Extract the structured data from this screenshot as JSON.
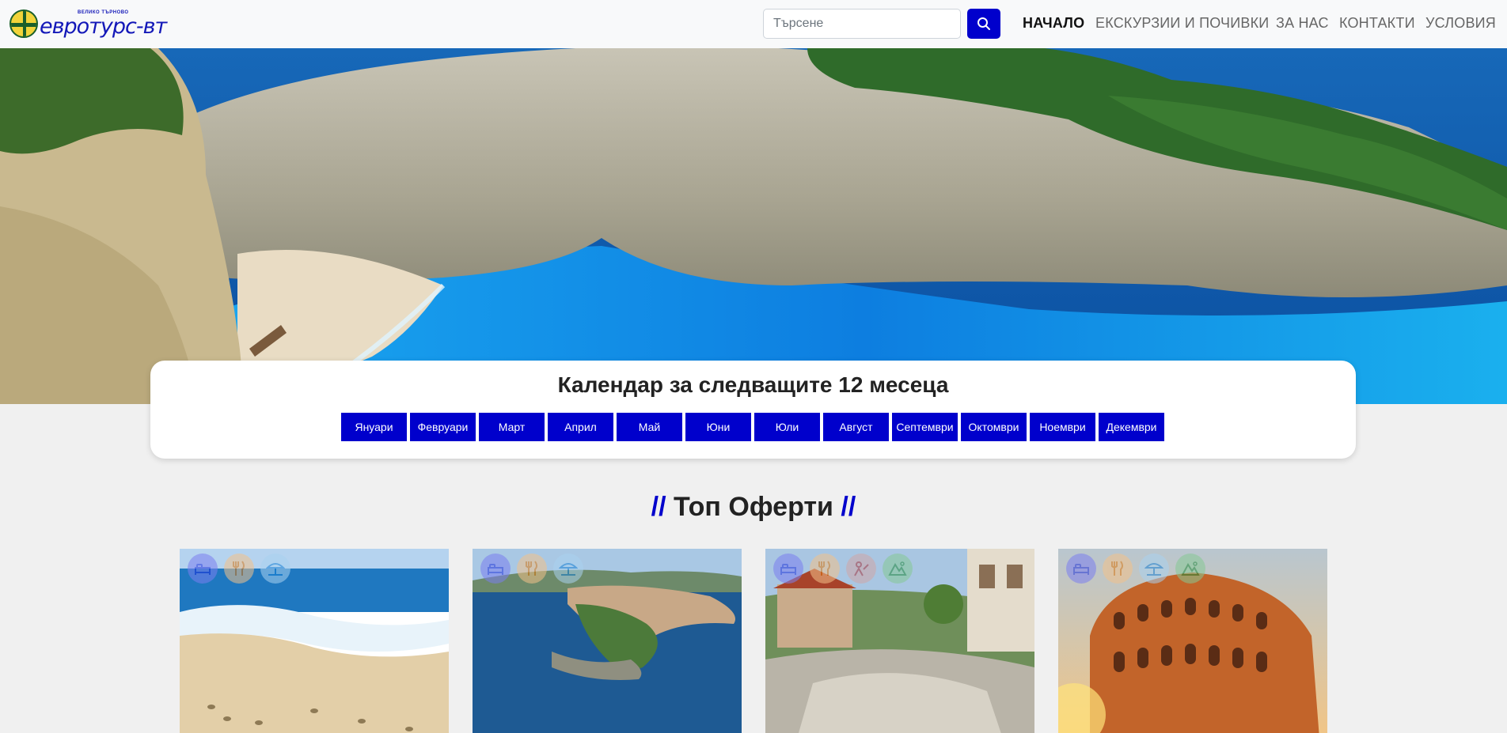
{
  "brand": {
    "logo_text": "евротурс-вт",
    "logo_tagline": "ВЕЛИКО ТЪРНОВО"
  },
  "search": {
    "placeholder": "Търсене",
    "icon": "search-icon"
  },
  "nav": {
    "items": [
      {
        "label": "НАЧАЛО",
        "active": true
      },
      {
        "label": "ЕКСКУРЗИИ И ПОЧИВКИ",
        "active": false
      },
      {
        "label": "ЗА НАС",
        "active": false
      },
      {
        "label": "КОНТАКТИ",
        "active": false
      },
      {
        "label": "УСЛОВИЯ",
        "active": false
      }
    ]
  },
  "calendar": {
    "title": "Календар за следващите 12 месеца",
    "months": [
      "Януари",
      "Февруари",
      "Март",
      "Април",
      "Май",
      "Юни",
      "Юли",
      "Август",
      "Септември",
      "Октомври",
      "Ноември",
      "Декември"
    ]
  },
  "top_offers": {
    "title": "Топ Оферти",
    "slash": "//",
    "cards": [
      {
        "photo": "beach-footprints",
        "amenities": [
          "bed-icon",
          "dining-icon",
          "beach-umbrella-icon"
        ]
      },
      {
        "photo": "coastal-peninsula",
        "amenities": [
          "bed-icon",
          "dining-icon",
          "beach-umbrella-icon"
        ]
      },
      {
        "photo": "village-street",
        "amenities": [
          "bed-icon",
          "dining-icon",
          "sightseeing-icon",
          "mountain-icon"
        ]
      },
      {
        "photo": "colosseum",
        "amenities": [
          "bed-icon",
          "dining-icon",
          "beach-umbrella-icon",
          "mountain-icon"
        ]
      }
    ]
  },
  "colors": {
    "accent": "#0000cc",
    "page_bg": "#f0f0f0",
    "navbar_bg": "#f8f9fa"
  }
}
